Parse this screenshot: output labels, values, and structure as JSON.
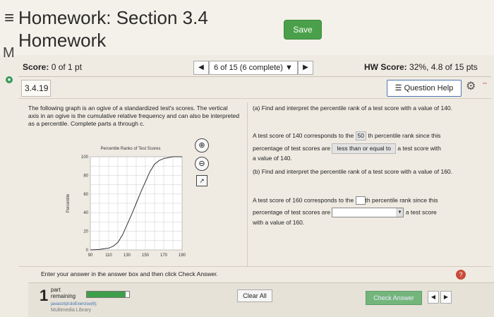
{
  "header": {
    "menu_icon": "hamburger-icon",
    "title_line1": "Homework: Section 3.4",
    "title_line2": "Homework",
    "save_label": "Save",
    "side_letter": "M"
  },
  "score_bar": {
    "score_label": "Score:",
    "score_value": "0 of 1 pt",
    "nav_text": "6 of 15 (6 complete) ▼",
    "hw_score_label": "HW Score:",
    "hw_score_value": "32%, 4.8 of 15 pts"
  },
  "question": {
    "number": "3.4.19",
    "help_label": "Question Help",
    "intro": "The following graph is an ogive of a standardized test's scores. The vertical axis in an ogive is the cumulative relative frequency and can also be interpreted as a percentile. Complete parts a through c."
  },
  "part_a": {
    "prompt": "(a) Find and interpret the percentile rank of a test score with a value of 140.",
    "line1_pre": "A test score of 140 corresponds to the",
    "answer": "50",
    "line1_post": "th percentile rank since this",
    "line2_pre": "percentage of test scores are",
    "dropdown": "less than or equal to",
    "line2_post": "a test score with",
    "line3": "a value of 140."
  },
  "part_b": {
    "prompt": "(b) Find and interpret the percentile rank of a test score with a value of 160.",
    "line1_pre": "A test score of 160 corresponds to the",
    "line1_post": "th percentile rank since this",
    "line2_pre": "percentage of test scores are",
    "line2_post": "a test score",
    "line3": "with a value of 160."
  },
  "footer": {
    "instruction": "Enter your answer in the answer box and then click Check Answer.",
    "parts_number": "1",
    "parts_label_1": "part",
    "parts_label_2": "remaining",
    "progress": 0.95,
    "js_link": "javascript:doExercise(6);",
    "multimedia": "Multimedia Library",
    "clear_label": "Clear All",
    "check_label": "Check Answer"
  },
  "chart_data": {
    "type": "line",
    "title": "Percentile Ranks of Test Scores",
    "xlabel": "",
    "ylabel": "Percentile",
    "xlim": [
      90,
      190
    ],
    "ylim": [
      0,
      100
    ],
    "x_ticks": [
      90,
      110,
      130,
      150,
      170,
      190
    ],
    "y_ticks": [
      0,
      20,
      40,
      60,
      80,
      100
    ],
    "grid": true,
    "x": [
      90,
      100,
      110,
      115,
      120,
      125,
      130,
      135,
      140,
      145,
      150,
      155,
      160,
      165,
      170,
      175,
      180,
      190
    ],
    "values": [
      0,
      0.5,
      2,
      4,
      8,
      16,
      27,
      38,
      50,
      62,
      73,
      84,
      92,
      96,
      98,
      99,
      100,
      100
    ]
  }
}
